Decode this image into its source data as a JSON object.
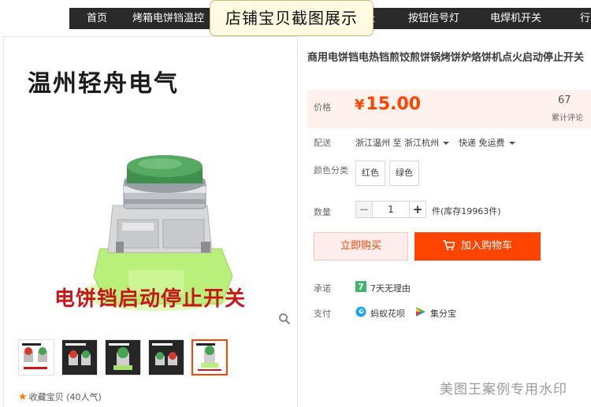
{
  "nav": {
    "items": [
      "首页",
      "烤箱电饼铛温控",
      "按钮信号灯",
      "电焊机开关",
      "行"
    ],
    "partial_item": "夭"
  },
  "banner": {
    "text": "店铺宝贝截图展示"
  },
  "gallery": {
    "brand": "温州轻舟电气",
    "caption": "电饼铛启动停止开关",
    "favorite_label": "收藏宝贝",
    "favorite_count": "(40人气)",
    "thumb_count": 5,
    "active_thumb": 4
  },
  "product": {
    "title": "商用电饼铛电热铛煎饺煎饼锅烤饼炉烙饼机点火启动停止开关",
    "price_label": "价格",
    "currency": "¥",
    "price": "15.00",
    "review_count": "67",
    "review_label": "累计评论",
    "shipping_label": "配送",
    "ship_from": "浙江温州 至",
    "ship_to": "浙江杭州",
    "delivery": "快递 免运费",
    "color_label": "颜色分类",
    "colors": [
      "红色",
      "绿色"
    ],
    "qty_label": "数量",
    "qty_value": "1",
    "stock_text": "件(库存19963件)",
    "buy_now": "立即购买",
    "add_to_cart": "加入购物车",
    "promise_label": "承诺",
    "promise_badge": "7",
    "promise_text": "7天无理由",
    "pay_label": "支付",
    "pay_methods": [
      "蚂蚁花呗",
      "集分宝"
    ]
  },
  "watermark": "美图王案例专用水印",
  "colors": {
    "accent": "#ff4400",
    "nav_bg": "#2a2a2a",
    "price_bg": "#fff1eb",
    "buy_bg": "#ffeded",
    "promise_green": "#3cb86a",
    "caption_red": "#c8161d"
  }
}
